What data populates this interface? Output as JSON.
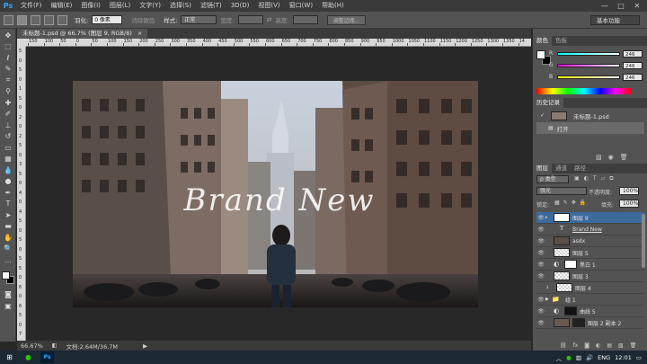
{
  "menubar": {
    "logo": "Ps",
    "items": [
      "文件(F)",
      "编辑(E)",
      "图像(I)",
      "图层(L)",
      "文字(Y)",
      "选择(S)",
      "滤镜(T)",
      "3D(D)",
      "视图(V)",
      "窗口(W)",
      "帮助(H)"
    ],
    "window_controls": [
      "—",
      "□",
      "✕"
    ]
  },
  "options_bar": {
    "feather_label": "羽化:",
    "feather_value": "0 像素",
    "antialias_label": "消除锯齿",
    "style_label": "样式:",
    "style_value": "正常",
    "width_label": "宽度:",
    "height_label": "高度:",
    "refine_edge": "调整边缘...",
    "workspace": "基本功能"
  },
  "document": {
    "tab_title": "未标题-1.psd @ 66.7% (图层 9, RGB/8)",
    "tab_close": "×",
    "canvas_text": "Brand New"
  },
  "ruler": {
    "h_ticks": [
      "150",
      "100",
      "50",
      "0",
      "50",
      "100",
      "150",
      "200",
      "250",
      "300",
      "350",
      "400",
      "450",
      "500",
      "550",
      "600",
      "650",
      "700",
      "750",
      "800",
      "850",
      "900",
      "950",
      "1000",
      "1050",
      "1100",
      "1150",
      "1200",
      "1250",
      "1300",
      "1350",
      "14"
    ],
    "v_ticks": [
      "5",
      "0",
      "5",
      "0",
      "1",
      "5",
      "0",
      "2",
      "0",
      "2",
      "5",
      "0",
      "3",
      "5",
      "0",
      "4",
      "0",
      "4",
      "5",
      "0",
      "5",
      "0",
      "5",
      "5",
      "0",
      "6",
      "0",
      "6",
      "5",
      "0",
      "7"
    ]
  },
  "status": {
    "zoom": "66.67%",
    "doc_info": "文档:2.64M/36.7M"
  },
  "color_panel": {
    "tabs": [
      "颜色",
      "色板"
    ],
    "channels": [
      {
        "label": "R",
        "value": "246"
      },
      {
        "label": "G",
        "value": "246"
      },
      {
        "label": "B",
        "value": "246"
      }
    ],
    "foreground": "#f6f6f6",
    "background": "#000000"
  },
  "history_panel": {
    "tab": "历史记录",
    "items": [
      {
        "label": "未标题-1.psd"
      },
      {
        "label": "打开"
      }
    ]
  },
  "layers_panel": {
    "tabs": [
      "图层",
      "通道",
      "路径"
    ],
    "kind_label": "ρ 类型",
    "blend_mode": "强光",
    "opacity_label": "不透明度:",
    "opacity_value": "100%",
    "lock_label": "锁定:",
    "fill_label": "填充:",
    "fill_value": "100%",
    "layers": [
      {
        "name": "图层 9",
        "type": "pixel",
        "selected": true
      },
      {
        "name": "Brand New",
        "type": "text"
      },
      {
        "name": "asdx",
        "type": "pixel"
      },
      {
        "name": "图层 5",
        "type": "pixel"
      },
      {
        "name": "黑白 1",
        "type": "adjustment"
      },
      {
        "name": "图层 3",
        "type": "pixel"
      },
      {
        "name": "图层 4",
        "type": "pixel"
      },
      {
        "name": "组 1",
        "type": "group"
      },
      {
        "name": "曲线 5",
        "type": "adjustment"
      },
      {
        "name": "图层 2 副本 2",
        "type": "pixel"
      }
    ]
  },
  "taskbar": {
    "time": "12:01",
    "ime": "ENG"
  },
  "colors": {
    "accent": "#31a8ff",
    "panel_bg": "#535353",
    "dark_bg": "#282828",
    "selected_layer": "#3c6a9c"
  }
}
